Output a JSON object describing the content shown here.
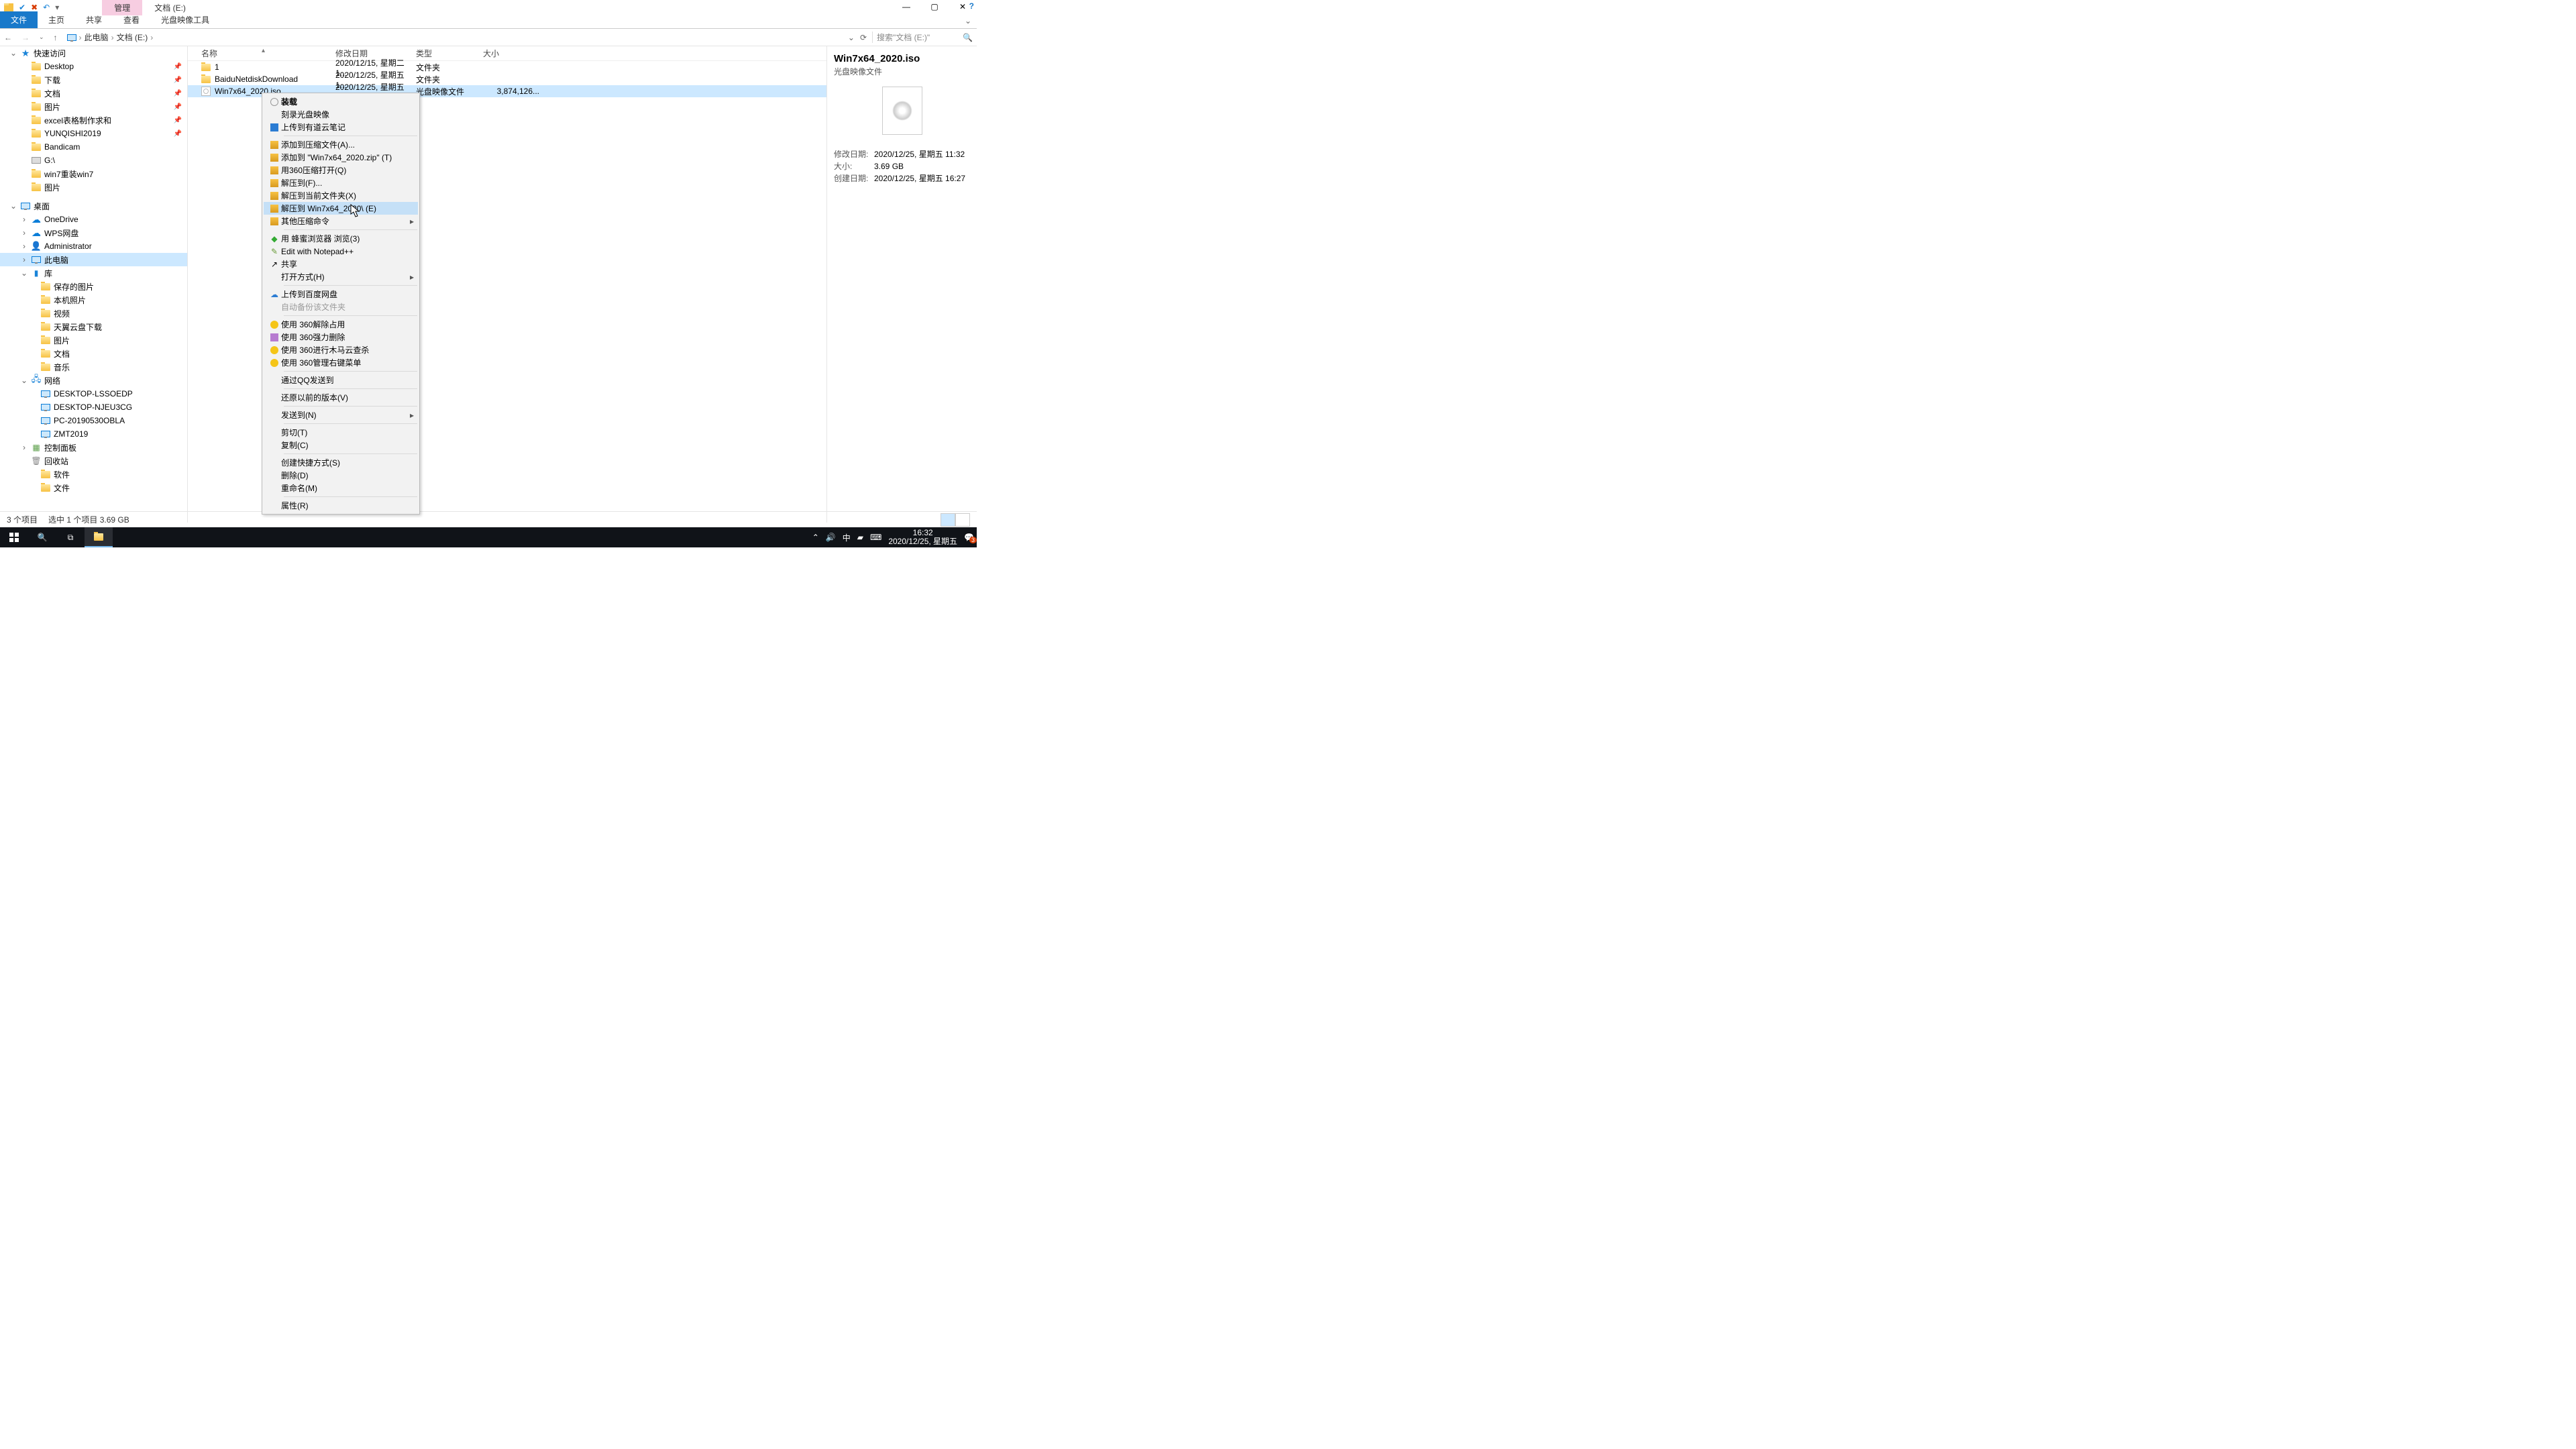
{
  "window": {
    "tab_manage": "管理",
    "tab_location": "文档 (E:)",
    "help_tip": "?"
  },
  "ribbon": {
    "file": "文件",
    "home": "主页",
    "share": "共享",
    "view": "查看",
    "isotools": "光盘映像工具"
  },
  "addr": {
    "root": "此电脑",
    "loc": "文档 (E:)",
    "search_ph": "搜索\"文档 (E:)\""
  },
  "nav": {
    "quick": "快速访问",
    "items1": [
      {
        "l": "Desktop"
      },
      {
        "l": "下载"
      },
      {
        "l": "文档"
      },
      {
        "l": "图片"
      },
      {
        "l": "excel表格制作求和"
      },
      {
        "l": "YUNQISHI2019"
      },
      {
        "l": "Bandicam"
      },
      {
        "l": "G:\\"
      },
      {
        "l": "win7重装win7"
      },
      {
        "l": "图片"
      }
    ],
    "desktop": "桌面",
    "items2": [
      {
        "l": "OneDrive",
        "t": "cloud"
      },
      {
        "l": "WPS网盘",
        "t": "cloud"
      },
      {
        "l": "Administrator",
        "t": "user"
      },
      {
        "l": "此电脑",
        "t": "pc",
        "sel": true
      },
      {
        "l": "库",
        "t": "lib"
      },
      {
        "l": "保存的图片"
      },
      {
        "l": "本机照片"
      },
      {
        "l": "视频"
      },
      {
        "l": "天翼云盘下载"
      },
      {
        "l": "图片"
      },
      {
        "l": "文档"
      },
      {
        "l": "音乐"
      },
      {
        "l": "网络",
        "t": "net"
      },
      {
        "l": "DESKTOP-LSSOEDP",
        "t": "pc"
      },
      {
        "l": "DESKTOP-NJEU3CG",
        "t": "pc"
      },
      {
        "l": "PC-20190530OBLA",
        "t": "pc"
      },
      {
        "l": "ZMT2019",
        "t": "pc"
      },
      {
        "l": "控制面板",
        "t": "panel"
      },
      {
        "l": "回收站",
        "t": "bin"
      },
      {
        "l": "软件"
      },
      {
        "l": "文件"
      }
    ]
  },
  "cols": {
    "name": "名称",
    "date": "修改日期",
    "type": "类型",
    "size": "大小"
  },
  "rows": [
    {
      "n": "1",
      "d": "2020/12/15, 星期二 1...",
      "t": "文件夹",
      "s": "",
      "k": "folder"
    },
    {
      "n": "BaiduNetdiskDownload",
      "d": "2020/12/25, 星期五 1...",
      "t": "文件夹",
      "s": "",
      "k": "folder"
    },
    {
      "n": "Win7x64_2020.iso",
      "d": "2020/12/25, 星期五 1...",
      "t": "光盘映像文件",
      "s": "3,874,126...",
      "k": "iso",
      "sel": true
    }
  ],
  "ctx": [
    {
      "l": "装载",
      "b": true,
      "i": "disc"
    },
    {
      "l": "刻录光盘映像"
    },
    {
      "l": "上传到有道云笔记",
      "i": "blue"
    },
    {
      "sep": true
    },
    {
      "l": "添加到压缩文件(A)...",
      "i": "zip"
    },
    {
      "l": "添加到 \"Win7x64_2020.zip\" (T)",
      "i": "zip"
    },
    {
      "l": "用360压缩打开(Q)",
      "i": "zip"
    },
    {
      "l": "解压到(F)...",
      "i": "zip"
    },
    {
      "l": "解压到当前文件夹(X)",
      "i": "zip"
    },
    {
      "l": "解压到 Win7x64_2020\\ (E)",
      "i": "zip",
      "hover": true
    },
    {
      "l": "其他压缩命令",
      "i": "zip",
      "sub": true
    },
    {
      "sep": true
    },
    {
      "l": "用 蜂蜜浏览器 浏览(3)",
      "i": "green"
    },
    {
      "l": "Edit with Notepad++",
      "i": "npp"
    },
    {
      "l": "共享",
      "i": "share"
    },
    {
      "l": "打开方式(H)",
      "sub": true
    },
    {
      "sep": true
    },
    {
      "l": "上传到百度网盘",
      "i": "baidu"
    },
    {
      "l": "自动备份该文件夹",
      "dis": true
    },
    {
      "sep": true
    },
    {
      "l": "使用 360解除占用",
      "i": "y"
    },
    {
      "l": "使用 360强力删除",
      "i": "y2"
    },
    {
      "l": "使用 360进行木马云查杀",
      "i": "y"
    },
    {
      "l": "使用 360管理右键菜单",
      "i": "y"
    },
    {
      "sep": true
    },
    {
      "l": "通过QQ发送到"
    },
    {
      "sep": true
    },
    {
      "l": "还原以前的版本(V)"
    },
    {
      "sep": true
    },
    {
      "l": "发送到(N)",
      "sub": true
    },
    {
      "sep": true
    },
    {
      "l": "剪切(T)"
    },
    {
      "l": "复制(C)"
    },
    {
      "sep": true
    },
    {
      "l": "创建快捷方式(S)"
    },
    {
      "l": "删除(D)"
    },
    {
      "l": "重命名(M)"
    },
    {
      "sep": true
    },
    {
      "l": "属性(R)"
    }
  ],
  "details": {
    "name": "Win7x64_2020.iso",
    "type": "光盘映像文件",
    "meta": [
      {
        "k": "修改日期:",
        "v": "2020/12/25, 星期五 11:32"
      },
      {
        "k": "大小:",
        "v": "3.69 GB"
      },
      {
        "k": "创建日期:",
        "v": "2020/12/25, 星期五 16:27"
      }
    ]
  },
  "status": {
    "a": "3 个项目",
    "b": "选中 1 个项目  3.69 GB"
  },
  "task": {
    "ime": "中",
    "time": "16:32",
    "date": "2020/12/25, 星期五",
    "notif": "3"
  }
}
